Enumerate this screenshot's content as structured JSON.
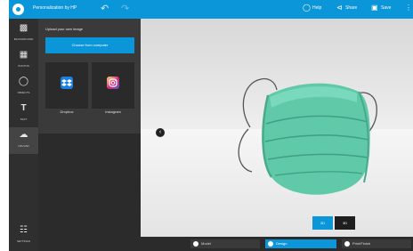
{
  "app": {
    "title": "Personalization by HP"
  },
  "topbar": {
    "undo_icon": "undo-arrow-icon",
    "redo_icon": "redo-arrow-icon",
    "help_label": "Help",
    "share_label": "Share",
    "save_label": "Save"
  },
  "sidebar": {
    "items": [
      {
        "label": "BACKGROUND",
        "icon": "background-icon"
      },
      {
        "label": "PHOTOS",
        "icon": "image-icon"
      },
      {
        "label": "OBJECTS",
        "icon": "objects-icon"
      },
      {
        "label": "TEXT",
        "icon": "text-t-icon"
      },
      {
        "label": "UPLOAD",
        "icon": "cloud-upload-icon"
      }
    ],
    "settings_label": "SETTINGS"
  },
  "panel": {
    "title": "Upload your own image",
    "choose_label": "Choose from computer",
    "sources": [
      {
        "label": "Dropbox",
        "icon": "dropbox-icon",
        "color": "#1f7fe0"
      },
      {
        "label": "Instagram",
        "icon": "instagram-icon",
        "color": "#d62976"
      }
    ]
  },
  "stage": {
    "nav_icon": "chevron-left-icon",
    "view_toggle": {
      "option_2d": "2D",
      "option_3d": "3D",
      "selected": "2D"
    },
    "mask_color": "#5fc9a8"
  },
  "steps": [
    {
      "label": "Model",
      "active": false
    },
    {
      "label": "Design",
      "active": true
    },
    {
      "label": "Print/Finish",
      "active": false
    }
  ],
  "colors": {
    "accent": "#0a96d8",
    "sidebar_bg": "#2f2f2f",
    "panel_bg": "#3a3a3a"
  }
}
